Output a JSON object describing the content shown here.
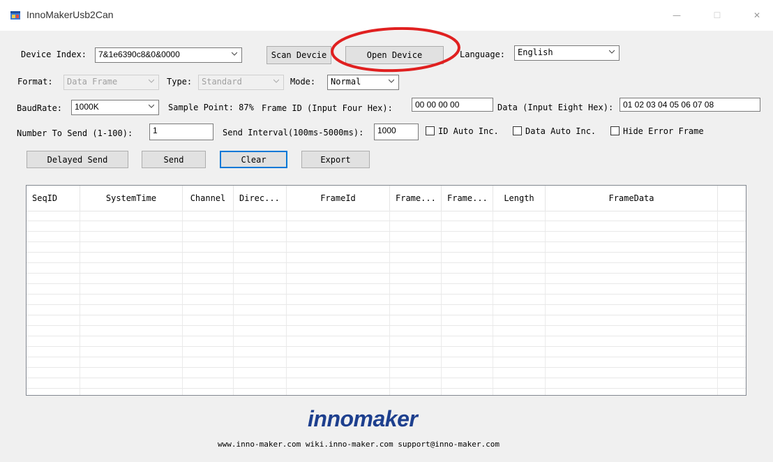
{
  "window": {
    "title": "InnoMakerUsb2Can",
    "minimize_glyph": "—",
    "maximize_glyph": "☐",
    "close_glyph": "✕",
    "icon": "app-window-icon"
  },
  "device": {
    "index_label": "Device Index:",
    "index_value": "7&1e6390c8&0&0000",
    "scan_button": "Scan Devcie",
    "open_button": "Open Device",
    "language_label": "Language:",
    "language_value": "English"
  },
  "frame_settings": {
    "format_label": "Format:",
    "format_value": "Data Frame",
    "type_label": "Type:",
    "type_value": "Standard",
    "mode_label": "Mode:",
    "mode_value": "Normal"
  },
  "baud": {
    "label": "BaudRate:",
    "value": "1000K",
    "sample_point": "Sample Point: 87%",
    "frame_id_label": "Frame ID (Input Four Hex):",
    "frame_id_value": "00 00 00 00",
    "data_label": "Data (Input Eight Hex):",
    "data_value": "01 02 03 04 05 06 07 08"
  },
  "send_opts": {
    "number_label": "Number To Send (1-100):",
    "number_value": "1",
    "interval_label": "Send Interval(100ms-5000ms):",
    "interval_value": "1000",
    "id_auto_inc": "ID Auto Inc.",
    "data_auto_inc": "Data Auto Inc.",
    "hide_error": "Hide Error Frame"
  },
  "actions": {
    "delayed_send": "Delayed Send",
    "send": "Send",
    "clear": "Clear",
    "export": "Export"
  },
  "table": {
    "columns": [
      "SeqID",
      "SystemTime",
      "Channel",
      "Direc...",
      "FrameId",
      "Frame...",
      "Frame...",
      "Length",
      "FrameData",
      ""
    ],
    "rows": []
  },
  "brand": {
    "logo_text": "innomaker",
    "footer": "www.inno-maker.com wiki.inno-maker.com support@inno-maker.com"
  },
  "colors": {
    "annotation_circle": "#e02020",
    "logo": "#1d3f8e",
    "focus": "#0078d7"
  }
}
